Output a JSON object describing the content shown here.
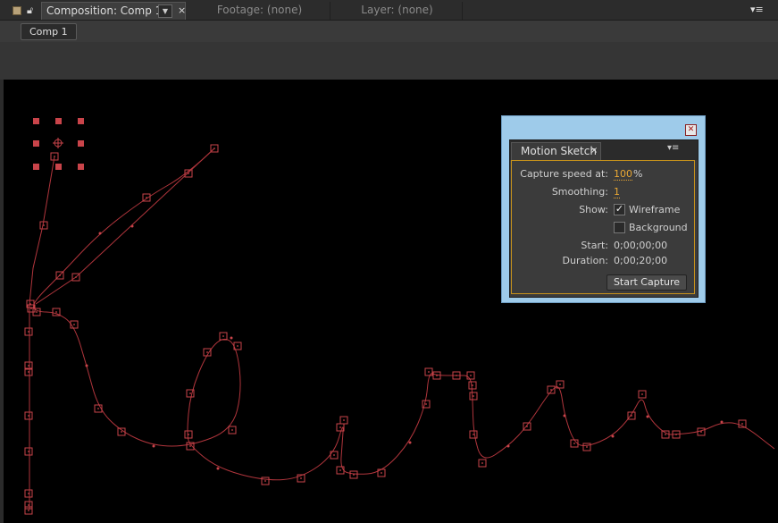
{
  "tabs": {
    "composition": "Composition: Comp 1",
    "footage": "Footage: (none)",
    "layer": "Layer: (none)",
    "close_glyph": "×",
    "dropdown_glyph": "▼",
    "menu_glyph": "▾≡"
  },
  "breadcrumb": "Comp 1",
  "motion_sketch": {
    "tab_label": "Motion Sketch",
    "close_glyph": "×",
    "menu_glyph": "▾≡",
    "capture_speed_label": "Capture speed at:",
    "capture_speed_value": "100",
    "capture_speed_unit": "%",
    "smoothing_label": "Smoothing:",
    "smoothing_value": "1",
    "show_label": "Show:",
    "wireframe_label": "Wireframe",
    "wireframe_checked": true,
    "background_label": "Background",
    "background_checked": false,
    "start_label": "Start:",
    "start_value": "0;00;00;00",
    "duration_label": "Duration:",
    "duration_value": "0;00;20;00",
    "start_capture_label": "Start Capture",
    "check_glyph": "✓"
  },
  "icons": {
    "lock": "lock-icon",
    "comp-color": "comp-color-icon",
    "dialog-close": "close-icon",
    "panel-menu": "panel-menu-icon"
  },
  "colors": {
    "path": "#b0353c",
    "keyframe": "#c9444a",
    "highlight": "#e8a734",
    "dialog_frame": "#9ecbea"
  }
}
